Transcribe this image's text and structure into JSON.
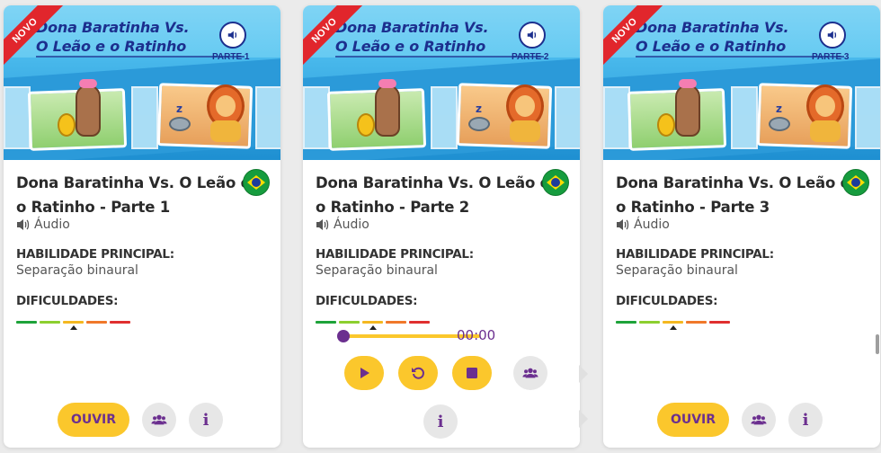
{
  "cards": [
    {
      "ribbon": "NOVO",
      "thumb_title_line1": "Dona Baratinha  Vs.",
      "thumb_title_line2": "O Leão e o Ratinho",
      "thumb_part": "PARTE 1",
      "title": "Dona Baratinha Vs. O Leão e o Ratinho - Parte 1",
      "media_type": "Áudio",
      "skill_label": "HABILIDADE PRINCIPAL:",
      "skill_value": "Separação binaural",
      "difficulty_label": "DIFICULDADES:",
      "primary_button": "OUVIR"
    },
    {
      "ribbon": "NOVO",
      "thumb_title_line1": "Dona Baratinha  Vs.",
      "thumb_title_line2": "O Leão e o Ratinho",
      "thumb_part": "PARTE 2",
      "title": "Dona Baratinha Vs. O Leão e o Ratinho - Parte 2",
      "media_type": "Áudio",
      "skill_label": "HABILIDADE PRINCIPAL:",
      "skill_value": "Separação binaural",
      "difficulty_label": "DIFICULDADES:",
      "player_time": "00:00",
      "player_progress": 0
    },
    {
      "ribbon": "NOVO",
      "thumb_title_line1": "Dona Baratinha  Vs.",
      "thumb_title_line2": "O Leão e o Ratinho",
      "thumb_part": "PARTE 3",
      "title": "Dona Baratinha Vs. O Leão e o Ratinho - Parte 3",
      "media_type": "Áudio",
      "skill_label": "HABILIDADE PRINCIPAL:",
      "skill_value": "Separação binaural",
      "difficulty_label": "DIFICULDADES:",
      "primary_button": "OUVIR"
    }
  ],
  "difficulty_scale": {
    "levels": 5,
    "selected_level": 3,
    "colors": [
      "#1ea33a",
      "#8ccf2f",
      "#f4b820",
      "#f0782a",
      "#e02f2f"
    ]
  },
  "icons": {
    "sound": "speaker-icon",
    "flag": "brazil-flag-icon",
    "group": "group-icon",
    "info": "info-icon",
    "play": "play-icon",
    "replay": "replay-icon",
    "stop": "stop-icon"
  },
  "info_glyph": "i",
  "colors": {
    "accent_yellow": "#fbc72c",
    "accent_purple": "#6b2f8f",
    "ribbon_red": "#e1262c"
  }
}
